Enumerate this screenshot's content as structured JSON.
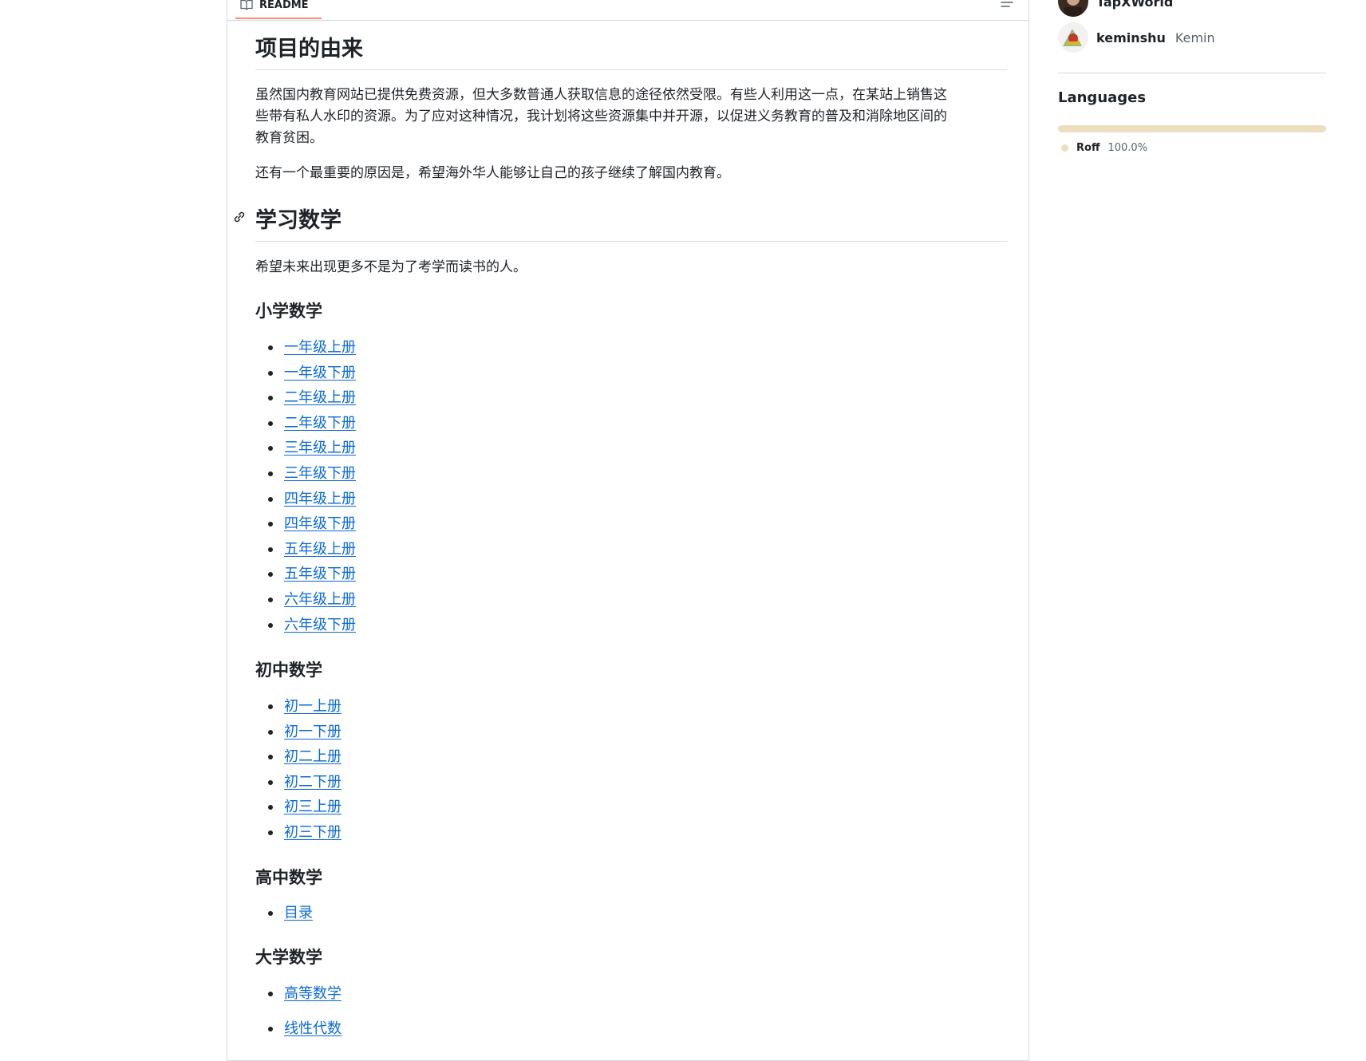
{
  "readme": {
    "tab_label": "README",
    "sections": {
      "origin": {
        "heading": "项目的由来",
        "para1_line1": "虽然国内教育网站已提供免费资源，但大多数普通人获取信息的途径依然受限。有些人利用这一点，在某站上销售这",
        "para1_line2": "些带有私人水印的资源。为了应对这种情况，我计划将这些资源集中并开源，以促进义务教育的普及和消除地区间的",
        "para1_line3": "教育贫困。",
        "para2": "还有一个最重要的原因是，希望海外华人能够让自己的孩子继续了解国内教育。"
      },
      "math": {
        "heading": "学习数学",
        "intro": "希望未来出现更多不是为了考学而读书的人。",
        "primary": {
          "heading": "小学数学",
          "links": [
            "一年级上册",
            "一年级下册",
            "二年级上册",
            "二年级下册",
            "三年级上册",
            "三年级下册",
            "四年级上册",
            "四年级下册",
            "五年级上册",
            "五年级下册",
            "六年级上册",
            "六年级下册"
          ]
        },
        "middle": {
          "heading": "初中数学",
          "links": [
            "初一上册",
            "初一下册",
            "初二上册",
            "初二下册",
            "初三上册",
            "初三下册"
          ]
        },
        "high": {
          "heading": "高中数学",
          "links": [
            "目录"
          ]
        },
        "university": {
          "heading": "大学数学",
          "links": [
            "高等数学",
            "线性代数"
          ]
        }
      }
    }
  },
  "sidebar": {
    "contributors": [
      {
        "login": "TapXWorld",
        "name": ""
      },
      {
        "login": "keminshu",
        "name": "Kemin"
      }
    ],
    "languages_title": "Languages",
    "languages": [
      {
        "name": "Roff",
        "percent": "100.0%",
        "color": "#ecdebe"
      }
    ]
  },
  "colors": {
    "link": "#0969da",
    "tab_underline": "#fd8c73",
    "border": "#d1d9e0"
  }
}
